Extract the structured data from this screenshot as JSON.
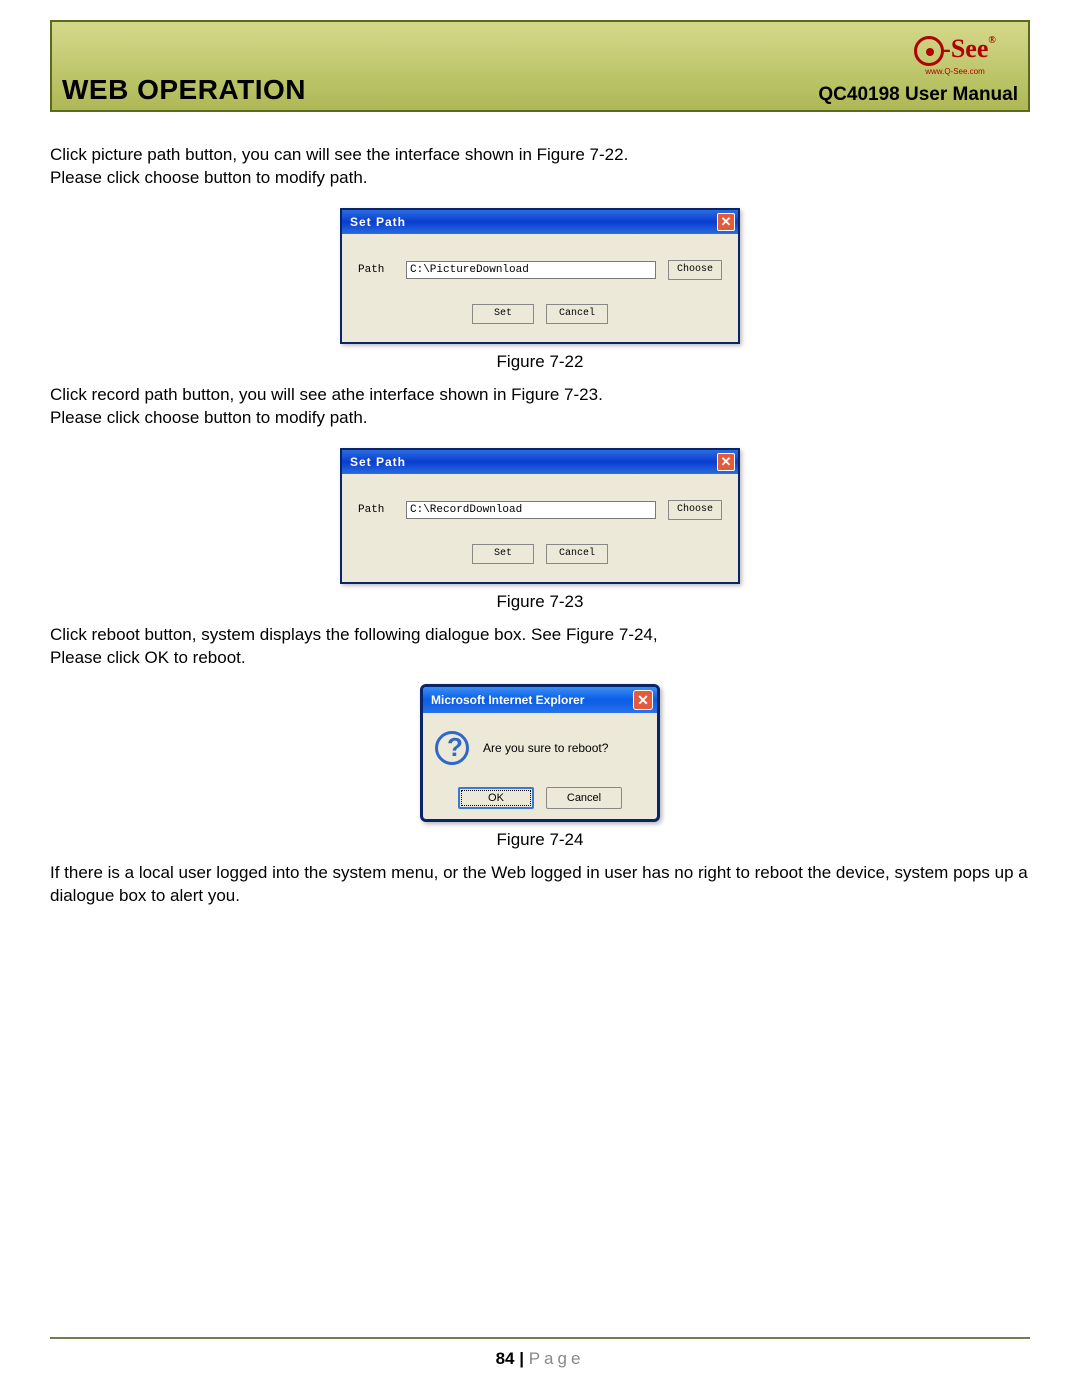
{
  "header": {
    "title": "WEB OPERATION",
    "subtitle": "QC40198 User Manual",
    "logo_text": "-See",
    "logo_url": "www.Q-See.com"
  },
  "paragraphs": {
    "p1a": "Click picture path button, you can will see the interface shown in Figure 7-22.",
    "p1b": "Please click choose button to modify path.",
    "p2a": "Click record path button, you will see athe interface shown in Figure 7-23.",
    "p2b": "Please click choose button to modify path.",
    "p3a": "Click reboot button, system displays the following dialogue box. See Figure 7-24,",
    "p3b": "Please click OK to reboot.",
    "p4": "If there is a local user logged into the system menu, or the Web logged in user has no right to reboot the device, system pops up a dialogue box to alert you."
  },
  "captions": {
    "fig22": "Figure 7-22",
    "fig23": "Figure 7-23",
    "fig24": "Figure 7-24"
  },
  "dialog22": {
    "title": "Set Path",
    "path_label": "Path",
    "path_value": "C:\\PictureDownload",
    "choose": "Choose",
    "set": "Set",
    "cancel": "Cancel"
  },
  "dialog23": {
    "title": "Set Path",
    "path_label": "Path",
    "path_value": "C:\\RecordDownload",
    "choose": "Choose",
    "set": "Set",
    "cancel": "Cancel"
  },
  "dialog24": {
    "title": "Microsoft Internet Explorer",
    "message": "Are you sure to reboot?",
    "ok": "OK",
    "cancel": "Cancel"
  },
  "footer": {
    "page_num": "84",
    "bar": " | ",
    "label": "Page"
  }
}
